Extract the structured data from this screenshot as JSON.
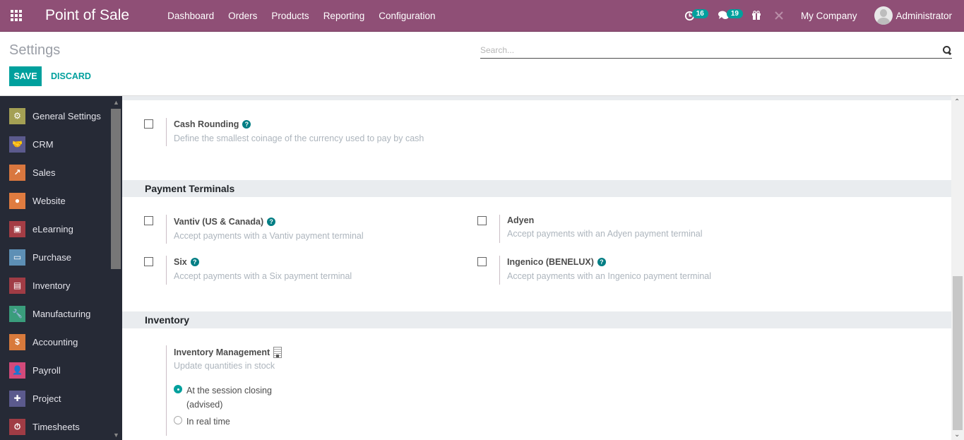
{
  "navbar": {
    "app_title": "Point of Sale",
    "menu": [
      "Dashboard",
      "Orders",
      "Products",
      "Reporting",
      "Configuration"
    ],
    "activity_count": "16",
    "message_count": "19",
    "company": "My Company",
    "user": "Administrator",
    "colors": {
      "navbar_bg": "#8f4f76",
      "badge": "#00a09d"
    }
  },
  "control_panel": {
    "title": "Settings",
    "save_label": "SAVE",
    "discard_label": "DISCARD",
    "search_placeholder": "Search...",
    "search_value": ""
  },
  "sidebar": {
    "items": [
      {
        "label": "General Settings",
        "icon": "gear-icon",
        "color": "#a4a054"
      },
      {
        "label": "CRM",
        "icon": "handshake-icon",
        "color": "#5b5a8d"
      },
      {
        "label": "Sales",
        "icon": "chart-up-icon",
        "color": "#d9773f"
      },
      {
        "label": "Website",
        "icon": "globe-icon",
        "color": "#e07c40"
      },
      {
        "label": "eLearning",
        "icon": "presentation-icon",
        "color": "#a43d45"
      },
      {
        "label": "Purchase",
        "icon": "credit-card-icon",
        "color": "#5d8fb5"
      },
      {
        "label": "Inventory",
        "icon": "box-icon",
        "color": "#a03c45"
      },
      {
        "label": "Manufacturing",
        "icon": "wrench-icon",
        "color": "#3a9d7c"
      },
      {
        "label": "Accounting",
        "icon": "invoice-icon",
        "color": "#d87a3c"
      },
      {
        "label": "Payroll",
        "icon": "user-card-icon",
        "color": "#d34a7a"
      },
      {
        "label": "Project",
        "icon": "puzzle-icon",
        "color": "#5b5a8d"
      },
      {
        "label": "Timesheets",
        "icon": "stopwatch-icon",
        "color": "#a03c45"
      }
    ]
  },
  "settings": {
    "cash_rounding": {
      "title": "Cash Rounding",
      "description": "Define the smallest coinage of the currency used to pay by cash",
      "checked": false
    },
    "payment_terminals": {
      "heading": "Payment Terminals",
      "items": [
        {
          "title": "Vantiv (US & Canada)",
          "description": "Accept payments with a Vantiv payment terminal",
          "help": true,
          "checked": false
        },
        {
          "title": "Adyen",
          "description": "Accept payments with an Adyen payment terminal",
          "help": false,
          "checked": false
        },
        {
          "title": "Six",
          "description": "Accept payments with a Six payment terminal",
          "help": true,
          "checked": false
        },
        {
          "title": "Ingenico (BENELUX)",
          "description": "Accept payments with an Ingenico payment terminal",
          "help": true,
          "checked": false
        }
      ]
    },
    "inventory": {
      "heading": "Inventory",
      "title": "Inventory Management",
      "description": "Update quantities in stock",
      "options": [
        {
          "label_line1": "At the session closing",
          "label_line2": "(advised)",
          "selected": true
        },
        {
          "label_line1": "In real time",
          "label_line2": "",
          "selected": false
        }
      ]
    }
  }
}
